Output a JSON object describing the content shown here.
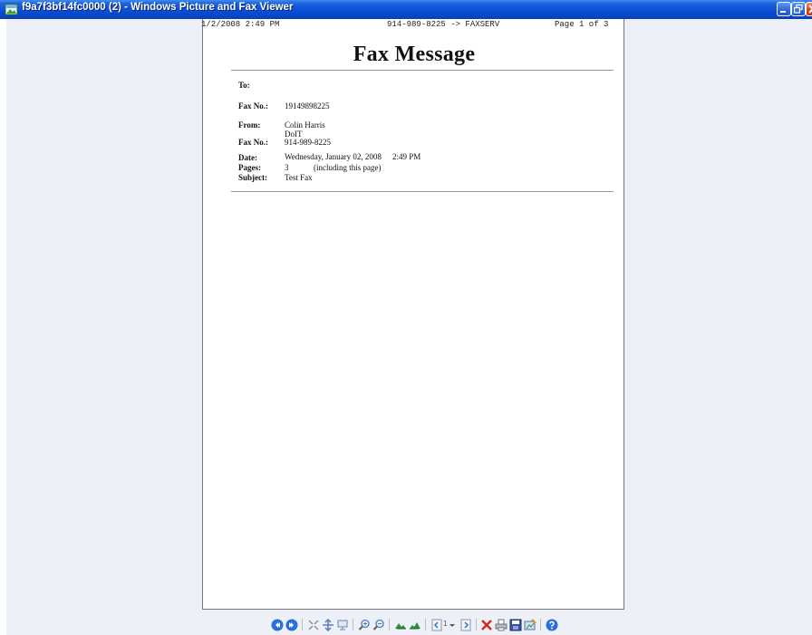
{
  "window": {
    "title": "f9a7f3bf14fc0000 (2) - Windows Picture and Fax Viewer"
  },
  "fax_header": {
    "left": "1/2/2008 2:49 PM",
    "middle": "914-989-8225 -> FAXSERV",
    "right": "Page  1 of 3"
  },
  "document": {
    "heading": "Fax Message",
    "fields": {
      "to_label": "To:",
      "to_value": "",
      "fax_no_label": "Fax No.:",
      "fax_no_value": "19149898225",
      "from_label": "From:",
      "from_name": "Colin Harris",
      "from_org": "DoIT",
      "from_fax_label": "Fax No.:",
      "from_fax_value": "914-989-8225",
      "date_label": "Date:",
      "date_value": "Wednesday, January 02, 2008",
      "time_value": "2:49 PM",
      "pages_label": "Pages:",
      "pages_value": "3",
      "pages_note": "(including this page)",
      "subject_label": "Subject:",
      "subject_value": "Test Fax"
    }
  },
  "toolbar": {
    "page_number": "1",
    "icons": [
      "previous-image-icon",
      "next-image-icon",
      "best-fit-icon",
      "actual-size-icon",
      "slideshow-icon",
      "zoom-in-icon",
      "zoom-out-icon",
      "rotate-clockwise-icon",
      "rotate-counterclockwise-icon",
      "previous-page-icon",
      "page-selector",
      "next-page-icon",
      "delete-icon",
      "print-icon",
      "save-icon",
      "edit-icon",
      "help-icon"
    ]
  }
}
